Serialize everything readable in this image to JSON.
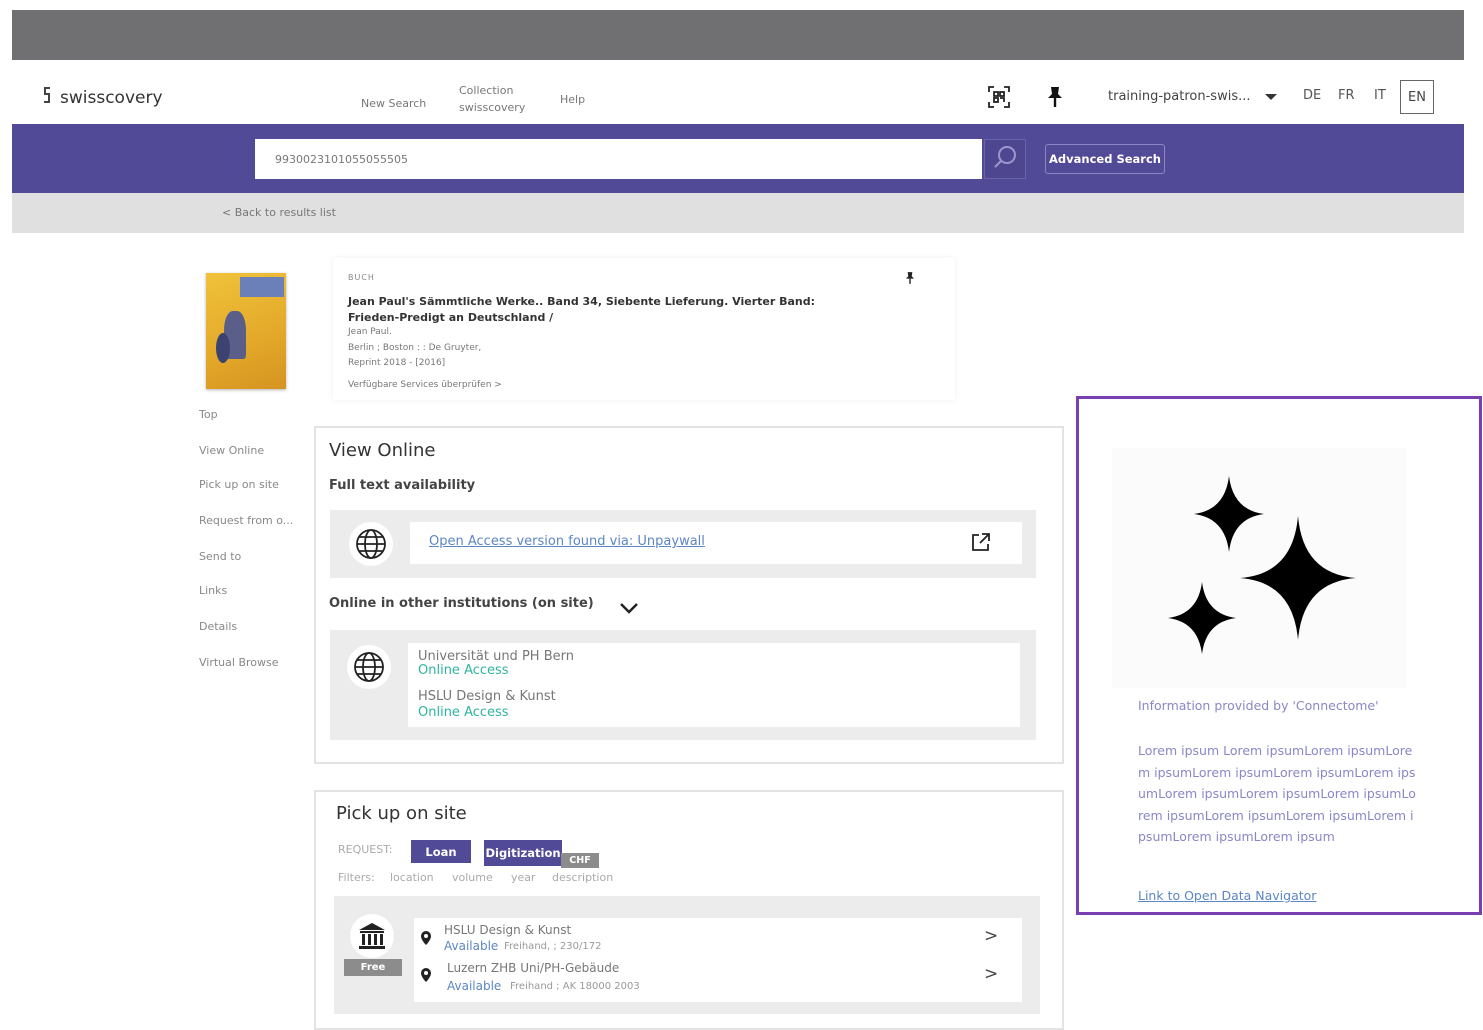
{
  "header": {
    "brand": "swisscovery",
    "nav": {
      "new_search": "New Search",
      "collection_line1": "Collection",
      "collection_line2": "swisscovery",
      "help": "Help"
    },
    "user": "training-patron-swis...",
    "languages": [
      "DE",
      "FR",
      "IT",
      "EN"
    ],
    "active_language": "EN"
  },
  "search": {
    "query": "9930023101055055505",
    "advanced_label": "Advanced Search"
  },
  "back_link": "< Back to results list",
  "record": {
    "type": "BUCH",
    "title": "Jean Paul's Sämmtliche Werke.. Band 34,  Siebente Lieferung. Vierter Band: Frieden-Predigt an Deutschland /",
    "author": "Jean Paul.",
    "publisher": "Berlin ; Boston : : De Gruyter,",
    "date": "Reprint 2018 - [2016]",
    "services": "Verfügbare Services überprüfen >"
  },
  "left_nav": [
    "Top",
    "View Online",
    "Pick up on site",
    "Request from o...",
    "Send to",
    "Links",
    "Details",
    "Virtual Browse"
  ],
  "view_online": {
    "title": "View Online",
    "full_text": "Full text availability",
    "oa_link": "Open Access version found via: Unpaywall",
    "other_institutions": "Online in other institutions (on site)",
    "institutions": [
      {
        "name": "Universität und PH Bern",
        "status": "Online Access"
      },
      {
        "name": "HSLU Design & Kunst",
        "status": "Online Access"
      }
    ]
  },
  "pickup": {
    "title": "Pick up on site",
    "request_label": "REQUEST:",
    "loan": "Loan",
    "digitization": "Digitization",
    "chf": "CHF",
    "filters_label": "Filters:",
    "filters": [
      "location",
      "volume",
      "year",
      "description"
    ],
    "free": "Free",
    "locations": [
      {
        "name": "HSLU Design & Kunst",
        "status": "Available",
        "shelf": "Freihand, ; 230/172"
      },
      {
        "name": "Luzern ZHB Uni/PH-Gebäude",
        "status": "Available",
        "shelf": "Freihand ; AK 18000 2003"
      }
    ]
  },
  "ai_panel": {
    "icon": "sparkles-icon",
    "info": "Information provided by 'Connectome'",
    "lorem": "Lorem ipsum Lorem ipsumLorem ipsumLorem ipsumLorem ipsumLorem ipsumLorem ipsumLorem ipsumLorem ipsumLorem ipsumLorem ipsumLorem ipsumLorem ipsumLorem ipsumLorem ipsumLorem ipsum",
    "link": "Link to Open Data Navigator"
  },
  "colors": {
    "brand_purple": "#514a97",
    "highlight_border": "#7a3fb0",
    "online_green": "#2fb49f",
    "link_blue": "#5c86c4"
  }
}
